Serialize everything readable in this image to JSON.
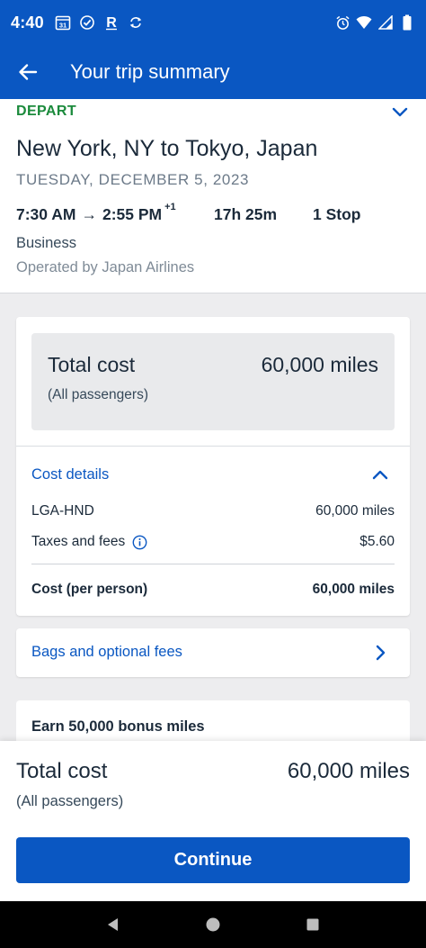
{
  "status_bar": {
    "time": "4:40",
    "calendar_day": "31",
    "left_icons": [
      "calendar-icon",
      "check-circle-icon",
      "r-brand-icon",
      "sync-icon"
    ],
    "right_icons": [
      "alarm-icon",
      "wifi-icon",
      "signal-icon",
      "battery-icon"
    ]
  },
  "app_bar": {
    "title": "Your trip summary",
    "back_icon": "arrow-left-icon"
  },
  "trip": {
    "label": "DEPART",
    "route": "New York, NY to Tokyo, Japan",
    "date": "TUESDAY, DECEMBER 5, 2023",
    "depart_time": "7:30 AM",
    "arrow": "→",
    "arrive_time": "2:55 PM",
    "day_offset": "+1",
    "duration": "17h 25m",
    "stops": "1 Stop",
    "cabin": "Business",
    "operated_by": "Operated by Japan Airlines"
  },
  "cost": {
    "total_label": "Total cost",
    "total_value": "60,000 miles",
    "total_sub": "(All passengers)",
    "details_label": "Cost details",
    "rows": [
      {
        "label": "LGA-HND",
        "value": "60,000 miles"
      },
      {
        "label": "Taxes and fees",
        "value": "$5.60"
      }
    ],
    "per_person_label": "Cost (per person)",
    "per_person_value": "60,000 miles"
  },
  "bags": {
    "label": "Bags and optional fees"
  },
  "bonus": {
    "label": "Earn 50,000 bonus miles"
  },
  "bottom": {
    "total_label": "Total cost",
    "total_value": "60,000 miles",
    "total_sub": "(All passengers)",
    "continue_label": "Continue"
  },
  "colors": {
    "brand_blue": "#0a57c2",
    "depart_green": "#1b8a3c",
    "text_dark": "#1b2a3a",
    "text_muted": "#6c7a89",
    "background": "#ededef"
  }
}
